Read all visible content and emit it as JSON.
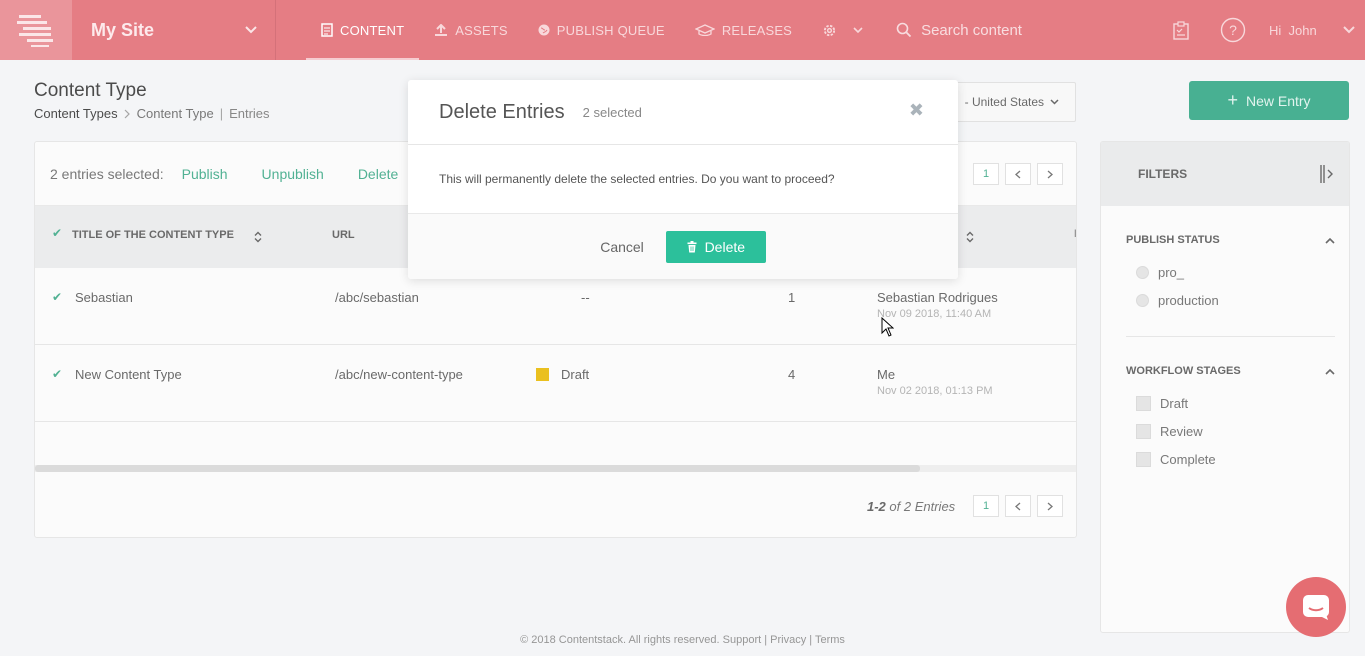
{
  "nav": {
    "site_name": "My Site",
    "items": [
      {
        "label": "CONTENT",
        "icon": "document-icon",
        "active": true
      },
      {
        "label": "ASSETS",
        "icon": "upload-icon"
      },
      {
        "label": "PUBLISH QUEUE",
        "icon": "globe-icon"
      },
      {
        "label": "RELEASES",
        "icon": "releases-icon"
      }
    ],
    "search_placeholder": "Search content",
    "greeting": "Hi  John"
  },
  "page": {
    "title": "Content Type",
    "breadcrumb": [
      "Content Types",
      "Content Type",
      "Entries"
    ],
    "locale": "- United States",
    "new_entry_label": "New Entry"
  },
  "bulk": {
    "selected_text": "2 entries selected:",
    "actions": [
      "Publish",
      "Unpublish",
      "Delete"
    ]
  },
  "pager": {
    "page": "1"
  },
  "table": {
    "columns": [
      "TITLE OF THE CONTENT TYPE",
      "URL"
    ],
    "rows": [
      {
        "title": "Sebastian",
        "url": "/abc/sebastian",
        "stage": "--",
        "version": "1",
        "user": "Sebastian Rodrigues",
        "date": "Nov 09 2018, 11:40 AM"
      },
      {
        "title": "New Content Type",
        "url": "/abc/new-content-type",
        "stage": "Draft",
        "version": "4",
        "user": "Me",
        "date": "Nov 02 2018, 01:13 PM"
      }
    ],
    "footer_range": "1-2",
    "footer_total": "of 2 Entries"
  },
  "filters": {
    "title": "FILTERS",
    "publish_status": {
      "title": "PUBLISH STATUS",
      "options": [
        "pro_",
        "production"
      ]
    },
    "workflow": {
      "title": "WORKFLOW STAGES",
      "options": [
        "Draft",
        "Review",
        "Complete"
      ]
    }
  },
  "footer": {
    "text": "© 2018 Contentstack. All rights reserved. Support | Privacy | Terms"
  },
  "modal": {
    "title": "Delete Entries",
    "count": "2 selected",
    "message": "This will permanently delete the selected entries. Do you want to proceed?",
    "cancel_label": "Cancel",
    "delete_label": "Delete"
  },
  "colors": {
    "brand": "#e26b74",
    "accent": "#2cc09b",
    "draft": "#e8b800"
  }
}
